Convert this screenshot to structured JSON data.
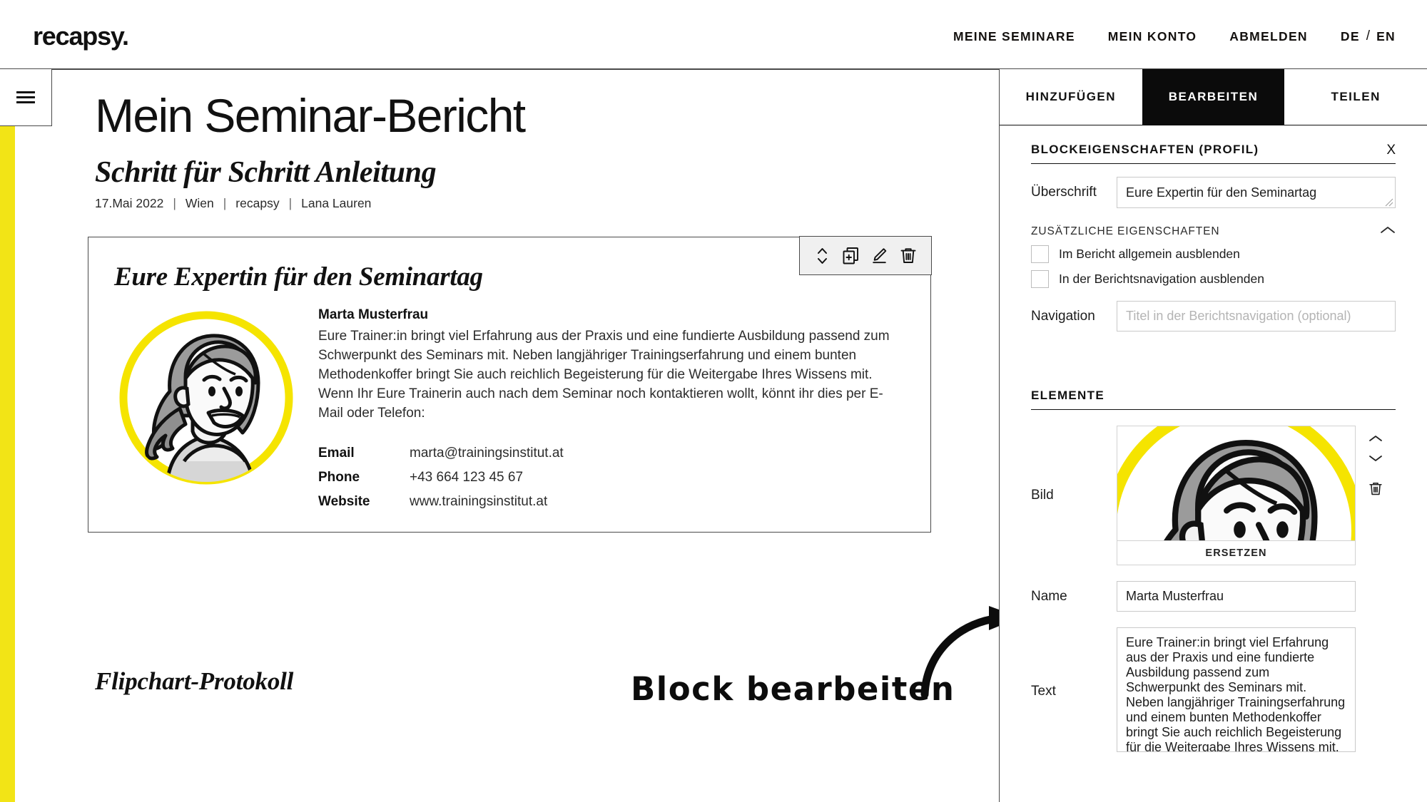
{
  "header": {
    "brand": "recapsy.",
    "nav": [
      {
        "label": "MEINE SEMINARE"
      },
      {
        "label": "MEIN KONTO"
      },
      {
        "label": "ABMELDEN"
      }
    ],
    "lang": {
      "de": "DE",
      "slash": "/",
      "en": "EN"
    }
  },
  "sidebar": {
    "menu_icon": "hamburger-icon"
  },
  "document": {
    "title": "Mein Seminar-Bericht",
    "subtitle": "Schritt für Schritt Anleitung",
    "meta": {
      "date": "17.Mai 2022",
      "location": "Wien",
      "organisation": "recapsy",
      "author": "Lana Lauren",
      "separator": "|"
    },
    "block": {
      "heading": "Eure Expertin für den Seminartag",
      "toolbar": [
        {
          "name": "move-icon",
          "title": "Verschieben"
        },
        {
          "name": "duplicate-icon",
          "title": "Duplizieren"
        },
        {
          "name": "edit-icon",
          "title": "Bearbeiten"
        },
        {
          "name": "delete-icon",
          "title": "Löschen"
        }
      ],
      "profile": {
        "name": "Marta Musterfrau",
        "body": "Eure Trainer:in bringt viel Erfahrung aus der Praxis und eine fundierte Ausbildung passend zum Schwerpunkt des Seminars mit. Neben langjähriger Trainingserfahrung und einem bunten Methodenkoffer bringt Sie auch reichlich Begeisterung für die Weitergabe Ihres Wissens mit. Wenn Ihr Eure Trainerin auch nach dem Seminar noch kontaktieren wollt, könnt ihr dies per E-Mail oder Telefon:",
        "contacts": [
          {
            "label": "Email",
            "value": "marta@trainingsinstitut.at"
          },
          {
            "label": "Phone",
            "value": "+43 664 123 45 67"
          },
          {
            "label": "Website",
            "value": "www.trainingsinstitut.at"
          }
        ]
      }
    },
    "next_block_heading": "Flipchart-Protokoll"
  },
  "annotation": {
    "text": "Block bearbeiten"
  },
  "panel": {
    "tabs": [
      {
        "label": "HINZUFÜGEN",
        "active": false
      },
      {
        "label": "BEARBEITEN",
        "active": true
      },
      {
        "label": "TEILEN",
        "active": false
      }
    ],
    "block_properties": {
      "title": "BLOCKEIGENSCHAFTEN (PROFIL)",
      "close_label": "X",
      "heading_field": {
        "label": "Überschrift",
        "value": "Eure Expertin für den Seminartag"
      },
      "additional": {
        "title": "ZUSÄTZLICHE EIGENSCHAFTEN",
        "collapse_icon": "chevron-up-icon",
        "checkboxes": [
          {
            "label": "Im Bericht allgemein ausblenden",
            "checked": false
          },
          {
            "label": "In der Berichtsnavigation ausblenden",
            "checked": false
          }
        ]
      },
      "navigation_field": {
        "label": "Navigation",
        "value": "",
        "placeholder": "Titel in der Berichtsnavigation (optional)"
      }
    },
    "elements": {
      "title": "ELEMENTE",
      "image": {
        "label": "Bild",
        "replace_label": "ERSETZEN",
        "controls": [
          {
            "name": "move-up-icon"
          },
          {
            "name": "move-down-icon"
          },
          {
            "name": "delete-icon"
          }
        ]
      },
      "name_field": {
        "label": "Name",
        "value": "Marta Musterfrau"
      },
      "text_field": {
        "label": "Text",
        "value": "Eure Trainer:in bringt viel Erfahrung aus der Praxis und eine fundierte Ausbildung passend zum Schwerpunkt des Seminars mit. Neben langjähriger Trainingserfahrung und einem bunten Methodenkoffer bringt Sie auch reichlich Begeisterung für die Weitergabe Ihres Wissens mit."
      }
    }
  },
  "colors": {
    "accent_yellow": "#f2e416",
    "ink": "#111111",
    "panel_active_bg": "#0b0b0b",
    "border": "#4a4a4a",
    "field_border": "#c9c9c9"
  }
}
